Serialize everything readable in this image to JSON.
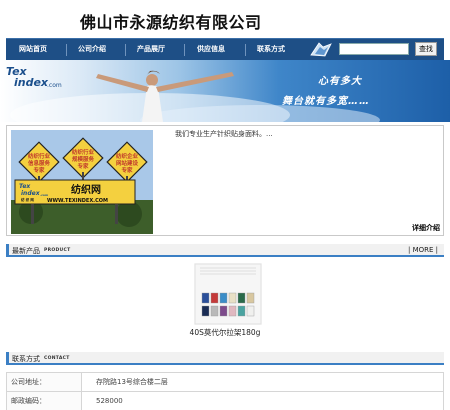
{
  "header": {
    "company_name": "佛山市永源纺织有限公司"
  },
  "nav": {
    "items": [
      "网站首页",
      "公司介绍",
      "产品展厅",
      "供应信息",
      "联系方式"
    ],
    "search_placeholder": "",
    "search_button": "查找"
  },
  "banner": {
    "logo_top": "Tex",
    "logo_bottom": "index",
    "logo_suffix": ".com",
    "slogan_line1": "心有多大",
    "slogan_line2": "舞台就有多宽……"
  },
  "intro": {
    "text": "我们专业生产针织贴身面料。...",
    "more_link": "详细介绍",
    "image": {
      "sign1": [
        "纺织行业",
        "信息服务",
        "专家"
      ],
      "sign2": [
        "纺织行业",
        "规模服务",
        "专家"
      ],
      "sign3": [
        "纺织企业",
        "网站建设",
        "专家"
      ],
      "board_logo_top": "Tex",
      "board_logo_bottom": "index",
      "board_logo_suffix": ".com",
      "board_logo_cn": "纺 织 网",
      "board_title": "纺织网",
      "board_url": "WWW.TEXINDEX.COM"
    }
  },
  "products": {
    "title": "最新产品",
    "title_en": "PRODUCT",
    "more": "| MORE |",
    "items": [
      {
        "name": "40S莫代尔拉架180g"
      }
    ],
    "swatch_colors": [
      "#2b4f9a",
      "#c43a3a",
      "#3b8dc8",
      "#e8e0c6",
      "#2a6a4a",
      "#d8c7a0",
      "#1a2d55",
      "#b9b9b9",
      "#7d4b8c",
      "#e0b8c0",
      "#4aa3a0",
      "#f0f0ee"
    ]
  },
  "contact": {
    "title": "联系方式",
    "title_en": "CONTACT",
    "rows": [
      {
        "label": "公司地址：",
        "value": "存院路13号综合楼二层"
      },
      {
        "label": "邮政编码：",
        "value": "528000"
      }
    ]
  },
  "colors": {
    "nav_background": "#1e4f86",
    "accent": "#3b7fc4",
    "banner_dark": "#1d5fa8"
  }
}
